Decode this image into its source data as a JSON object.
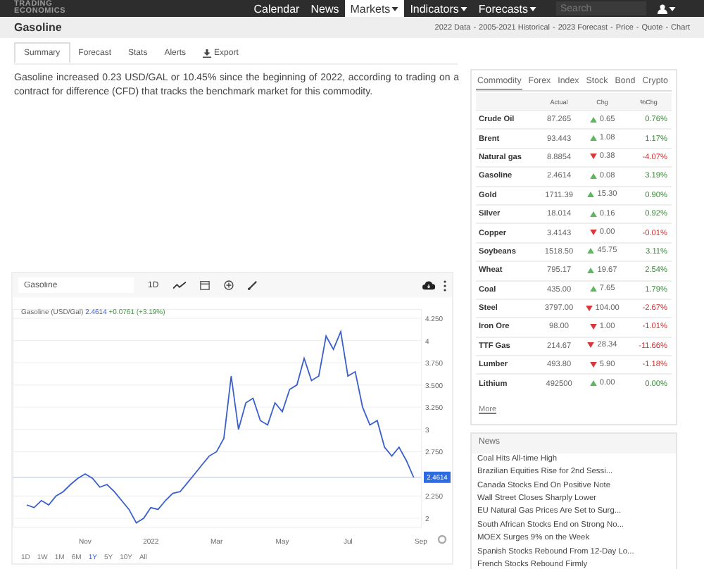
{
  "logo": {
    "line1": "TRADING",
    "line2": "ECONOMICS"
  },
  "nav": [
    {
      "label": "Calendar",
      "selected": false,
      "dropdown": false
    },
    {
      "label": "News",
      "selected": false,
      "dropdown": false
    },
    {
      "label": "Markets",
      "selected": true,
      "dropdown": true
    },
    {
      "label": "Indicators",
      "selected": false,
      "dropdown": true
    },
    {
      "label": "Forecasts",
      "selected": false,
      "dropdown": true
    }
  ],
  "search": {
    "placeholder": "Search"
  },
  "subheader": {
    "title": "Gasoline",
    "separator": "-",
    "links": [
      "2022 Data",
      "2005-2021 Historical",
      "2023 Forecast",
      "Price",
      "Quote",
      "Chart"
    ]
  },
  "tabs": [
    {
      "label": "Summary",
      "selected": true,
      "kind": "text"
    },
    {
      "label": "Forecast",
      "selected": false,
      "kind": "text"
    },
    {
      "label": "Stats",
      "selected": false,
      "kind": "text"
    },
    {
      "label": "Alerts",
      "selected": false,
      "kind": "text"
    },
    {
      "label": "Export",
      "selected": false,
      "kind": "download"
    }
  ],
  "summary": "Gasoline increased 0.23 USD/GAL or 10.45% since the beginning of 2022, according to trading on a contract for difference (CFD) that tracks the benchmark market for this commodity.",
  "chart": {
    "symbol_field": "Gasoline",
    "interval": "1D",
    "legend_name": "Gasoline (USD/Gal)",
    "legend_price": "2.4614",
    "legend_change": "+0.0761 (+3.19%)",
    "ranges": [
      {
        "label": "1D",
        "selected": false
      },
      {
        "label": "1W",
        "selected": false
      },
      {
        "label": "1M",
        "selected": false
      },
      {
        "label": "6M",
        "selected": false
      },
      {
        "label": "1Y",
        "selected": true
      },
      {
        "label": "5Y",
        "selected": false
      },
      {
        "label": "10Y",
        "selected": false
      },
      {
        "label": "All",
        "selected": false
      }
    ],
    "chart_data": {
      "type": "line",
      "grid": true,
      "ref_lines": [
        {
          "axis": "y",
          "value": 2.4614,
          "label": "2.4614"
        }
      ],
      "ylim": [
        1.9,
        4.35
      ],
      "categories": [
        null,
        null,
        null,
        null,
        null,
        null,
        null,
        null,
        "Nov",
        null,
        null,
        null,
        null,
        null,
        null,
        null,
        null,
        "2022",
        null,
        null,
        null,
        null,
        null,
        null,
        null,
        null,
        "Mar",
        null,
        null,
        null,
        null,
        null,
        null,
        null,
        null,
        "May",
        null,
        null,
        null,
        null,
        null,
        null,
        null,
        null,
        "Jul",
        null,
        null,
        null,
        null,
        null,
        null,
        null,
        null,
        null,
        "Sep"
      ],
      "yticks": [
        {
          "value": 2,
          "label": "2"
        },
        {
          "value": 2.25,
          "label": "2.250"
        },
        {
          "value": 2.75,
          "label": "2.750"
        },
        {
          "value": 3,
          "label": "3"
        },
        {
          "value": 3.25,
          "label": "3.250"
        },
        {
          "value": 3.5,
          "label": "3.500"
        },
        {
          "value": 3.75,
          "label": "3.750"
        },
        {
          "value": 4,
          "label": "4"
        },
        {
          "value": 4.25,
          "label": "4.250"
        }
      ],
      "series": [
        {
          "color": "#3a5fcd",
          "values": [
            2.15,
            2.12,
            2.2,
            2.15,
            2.25,
            2.3,
            2.38,
            2.45,
            2.5,
            2.45,
            2.35,
            2.38,
            2.3,
            2.2,
            2.1,
            1.95,
            2.0,
            2.12,
            2.1,
            2.2,
            2.28,
            2.3,
            2.4,
            2.5,
            2.6,
            2.7,
            2.75,
            2.9,
            3.6,
            3.0,
            3.3,
            3.35,
            3.1,
            3.05,
            3.3,
            3.2,
            3.45,
            3.5,
            3.8,
            3.55,
            3.6,
            4.05,
            3.9,
            4.1,
            3.6,
            3.65,
            3.25,
            3.05,
            3.1,
            2.8,
            2.7,
            2.8,
            2.65,
            2.46,
            null
          ]
        }
      ]
    }
  },
  "markets": {
    "tabs": [
      {
        "label": "Commodity",
        "selected": true
      },
      {
        "label": "Forex",
        "selected": false
      },
      {
        "label": "Index",
        "selected": false
      },
      {
        "label": "Stock",
        "selected": false
      },
      {
        "label": "Bond",
        "selected": false
      },
      {
        "label": "Crypto",
        "selected": false
      }
    ],
    "columns": [
      "Actual",
      "Chg",
      "%Chg"
    ],
    "rows": [
      {
        "name": "Crude Oil",
        "actual": "87.265",
        "up": true,
        "chg": "0.65",
        "pct": "0.76%"
      },
      {
        "name": "Brent",
        "actual": "93.443",
        "up": true,
        "chg": "1.08",
        "pct": "1.17%"
      },
      {
        "name": "Natural gas",
        "actual": "8.8854",
        "up": false,
        "chg": "0.38",
        "pct": "-4.07%"
      },
      {
        "name": "Gasoline",
        "actual": "2.4614",
        "up": true,
        "chg": "0.08",
        "pct": "3.19%"
      },
      {
        "name": "Gold",
        "actual": "1711.39",
        "up": true,
        "chg": "15.30",
        "pct": "0.90%"
      },
      {
        "name": "Silver",
        "actual": "18.014",
        "up": true,
        "chg": "0.16",
        "pct": "0.92%"
      },
      {
        "name": "Copper",
        "actual": "3.4143",
        "up": false,
        "chg": "0.00",
        "pct": "-0.01%"
      },
      {
        "name": "Soybeans",
        "actual": "1518.50",
        "up": true,
        "chg": "45.75",
        "pct": "3.11%"
      },
      {
        "name": "Wheat",
        "actual": "795.17",
        "up": true,
        "chg": "19.67",
        "pct": "2.54%"
      },
      {
        "name": "Coal",
        "actual": "435.00",
        "up": true,
        "chg": "7.65",
        "pct": "1.79%"
      },
      {
        "name": "Steel",
        "actual": "3797.00",
        "up": false,
        "chg": "104.00",
        "pct": "-2.67%"
      },
      {
        "name": "Iron Ore",
        "actual": "98.00",
        "up": false,
        "chg": "1.00",
        "pct": "-1.01%"
      },
      {
        "name": "TTF Gas",
        "actual": "214.67",
        "up": false,
        "chg": "28.34",
        "pct": "-11.66%"
      },
      {
        "name": "Lumber",
        "actual": "493.80",
        "up": false,
        "chg": "5.90",
        "pct": "-1.18%"
      },
      {
        "name": "Lithium",
        "actual": "492500",
        "up": true,
        "chg": "0.00",
        "pct": "0.00%"
      }
    ],
    "more": "More"
  },
  "news": {
    "title": "News",
    "items": [
      "Coal Hits All-time High",
      "Brazilian Equities Rise for 2nd Sessi...",
      "Canada Stocks End On Positive Note",
      "Wall Street Closes Sharply Lower",
      "EU Natural Gas Prices Are Set to Surg...",
      "South African Stocks End on Strong No...",
      "MOEX Surges 9% on the Week",
      "Spanish Stocks Rebound From 12-Day Lo...",
      "French Stocks Rebound Firmly"
    ]
  }
}
